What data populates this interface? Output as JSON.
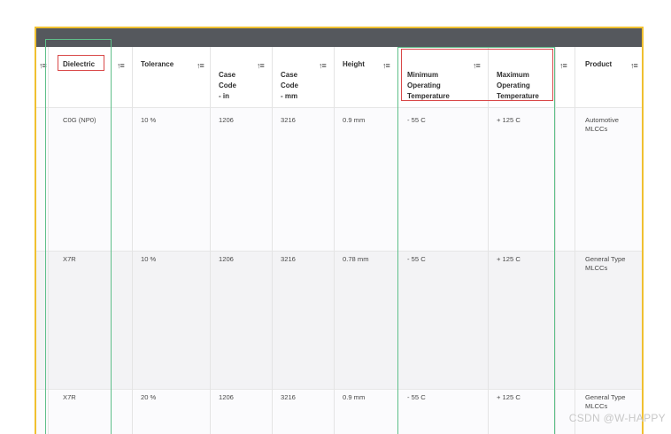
{
  "table": {
    "headers": [
      {
        "label": "Dielectric"
      },
      {
        "label": "Tolerance"
      },
      {
        "label": "Case\nCode\n- in"
      },
      {
        "label": "Case\nCode\n- mm"
      },
      {
        "label": "Height"
      },
      {
        "label": "Minimum\nOperating\nTemperature"
      },
      {
        "label": "Maximum\nOperating\nTemperature"
      },
      {
        "label": "Product"
      }
    ],
    "sort_icon": "sort-icon",
    "rows": [
      {
        "dielectric": "C0G (NP0)",
        "tolerance": "10 %",
        "case_in": "1206",
        "case_mm": "3216",
        "height": "0.9 mm",
        "min_temp": "- 55 C",
        "max_temp": "+ 125 C",
        "product": "Automotive\nMLCCs"
      },
      {
        "dielectric": "X7R",
        "tolerance": "10 %",
        "case_in": "1206",
        "case_mm": "3216",
        "height": "0.78 mm",
        "min_temp": "- 55 C",
        "max_temp": "+ 125 C",
        "product": "General Type\nMLCCs"
      },
      {
        "dielectric": "X7R",
        "tolerance": "20 %",
        "case_in": "1206",
        "case_mm": "3216",
        "height": "0.9 mm",
        "min_temp": "- 55 C",
        "max_temp": "+ 125 C",
        "product": "General Type\nMLCCs"
      }
    ]
  },
  "watermark": "CSDN @W-HAPPY",
  "colors": {
    "topbar": "#55585d",
    "frame": "#f0c030",
    "highlight_red": "#d94848",
    "highlight_green": "#5fbf8a"
  }
}
